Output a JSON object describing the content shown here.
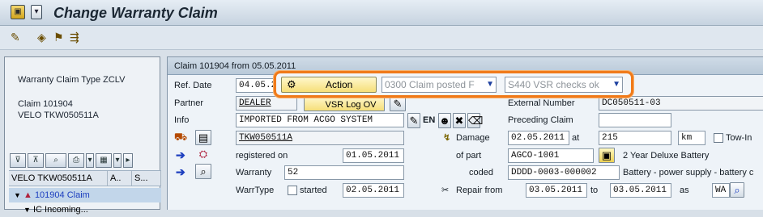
{
  "window": {
    "title": "Change Warranty Claim"
  },
  "left_panel": {
    "type_line": "Warranty Claim Type ZCLV",
    "claim_line": "Claim 101904",
    "object_line": "VELO TKW050511A",
    "columns": [
      "VELO TKW050511A",
      "A..",
      "S..."
    ],
    "tree": [
      "101904 Claim",
      "IC Incoming..."
    ]
  },
  "main": {
    "header": "Claim 101904 from 05.05.2011",
    "ref_date_label": "Ref. Date",
    "ref_date_value": "04.05.2011",
    "partner_label": "Partner",
    "partner_value": "DEALER",
    "vsr_button": "VSR Log OV",
    "info_label": "Info",
    "info_value": "IMPORTED FROM ACGO SYSTEM",
    "lang": "EN",
    "external_number_label": "External Number",
    "external_number_value": "DC050511-03",
    "preceding_claim_label": "Preceding Claim",
    "object_id": "TKW050511A",
    "registered_on_label": "registered on",
    "registered_on_value": "01.05.2011",
    "damage_label": "Damage",
    "damage_date": "02.05.2011",
    "at_label": "at",
    "damage_at_value": "215",
    "unit": "km",
    "tow_in_label": "Tow-In",
    "of_part_label": "of part",
    "of_part_value": "AGCO-1001",
    "part_desc": "2 Year Deluxe Battery",
    "warranty_label": "Warranty",
    "warranty_value": "52",
    "coded_label": "coded",
    "coded_value": "DDDD-0003-000002",
    "coded_desc": "Battery - power supply - battery c",
    "warrtype_label": "WarrType",
    "started_label": "started",
    "started_value": "02.05.2011",
    "repair_from_label": "Repair from",
    "repair_from_value": "03.05.2011",
    "to_label": "to",
    "repair_to_value": "03.05.2011",
    "as_label": "as",
    "as_value": "WA"
  },
  "popup": {
    "action_label": "Action",
    "status_dropdown": "0300 Claim posted F",
    "check_dropdown": "S440 VSR checks ok"
  },
  "colors": {
    "highlight": "#f07a1a",
    "title_bg": "#c6d3e0",
    "link": "#1d3fbf"
  }
}
